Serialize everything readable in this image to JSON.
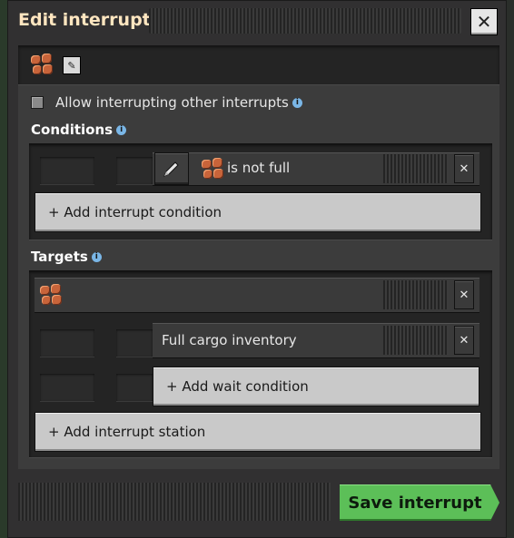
{
  "window": {
    "title": "Edit interrupt",
    "close_label": "✕"
  },
  "interrupt_name": {
    "edit_icon": "pencil-icon"
  },
  "allow_interrupting": {
    "label": "Allow interrupting other interrupts",
    "checked": false
  },
  "conditions": {
    "heading": "Conditions",
    "items": [
      {
        "text": "is not full",
        "icon": "copper-ore-icon"
      }
    ],
    "add_label": "+ Add interrupt condition"
  },
  "targets": {
    "heading": "Targets",
    "stations": [
      {
        "icon": "copper-ore-icon",
        "wait_conditions": [
          {
            "text": "Full cargo inventory"
          }
        ],
        "add_wait_label": "+ Add wait condition"
      }
    ],
    "add_station_label": "+ Add interrupt station"
  },
  "footer": {
    "save_label": "Save interrupt"
  },
  "colors": {
    "title": "#ffe6c0",
    "save": "#5cbf58",
    "info": "#7ab6e6",
    "ore": "#c8643a"
  }
}
